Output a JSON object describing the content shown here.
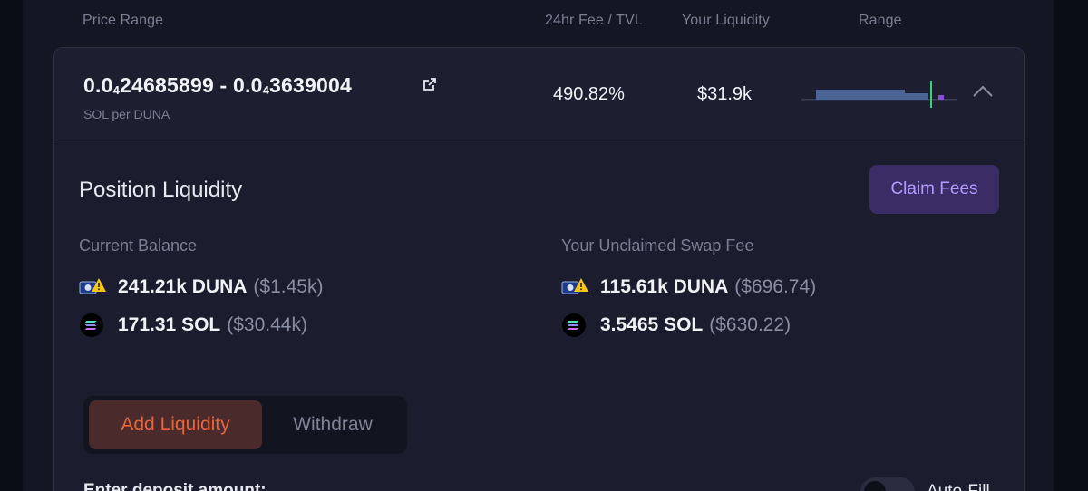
{
  "header": {
    "price_range": "Price Range",
    "fee_tvl": "24hr Fee / TVL",
    "your_liquidity": "Your Liquidity",
    "range": "Range"
  },
  "position": {
    "price_low_prefix": "0.0",
    "price_low_sub": "4",
    "price_low_rest": "24685899",
    "separator": " - ",
    "price_high_prefix": "0.0",
    "price_high_sub": "4",
    "price_high_rest": "3639004",
    "pair_label": "SOL per DUNA",
    "fee_tvl": "490.82%",
    "liquidity": "$31.9k",
    "external_link_icon": "external-link-icon",
    "collapse_icon": "chevron-up-icon"
  },
  "range_chart": {
    "colors": {
      "bar": "#4b6496",
      "current": "#3ad27a",
      "out": "#8a4fd8",
      "base": "#3b3f55"
    }
  },
  "details": {
    "title": "Position Liquidity",
    "claim_fees": "Claim Fees",
    "current_balance": {
      "label": "Current Balance",
      "tokens": [
        {
          "amount": "241.21k DUNA",
          "usd": "($1.45k)",
          "icon": "duna-token-icon"
        },
        {
          "amount": "171.31 SOL",
          "usd": "($30.44k)",
          "icon": "sol-token-icon"
        }
      ]
    },
    "unclaimed": {
      "label": "Your Unclaimed Swap Fee",
      "tokens": [
        {
          "amount": "115.61k DUNA",
          "usd": "($696.74)",
          "icon": "duna-token-icon"
        },
        {
          "amount": "3.5465 SOL",
          "usd": "($630.22)",
          "icon": "sol-token-icon"
        }
      ]
    }
  },
  "tabs": {
    "add": "Add Liquidity",
    "withdraw": "Withdraw",
    "active": "add"
  },
  "deposit": {
    "label": "Enter deposit amount:",
    "auto_fill": "Auto-Fill"
  },
  "colors": {
    "accent_purple": "#b69bff",
    "accent_orange": "#e5663f",
    "background": "#1b1d2e"
  }
}
